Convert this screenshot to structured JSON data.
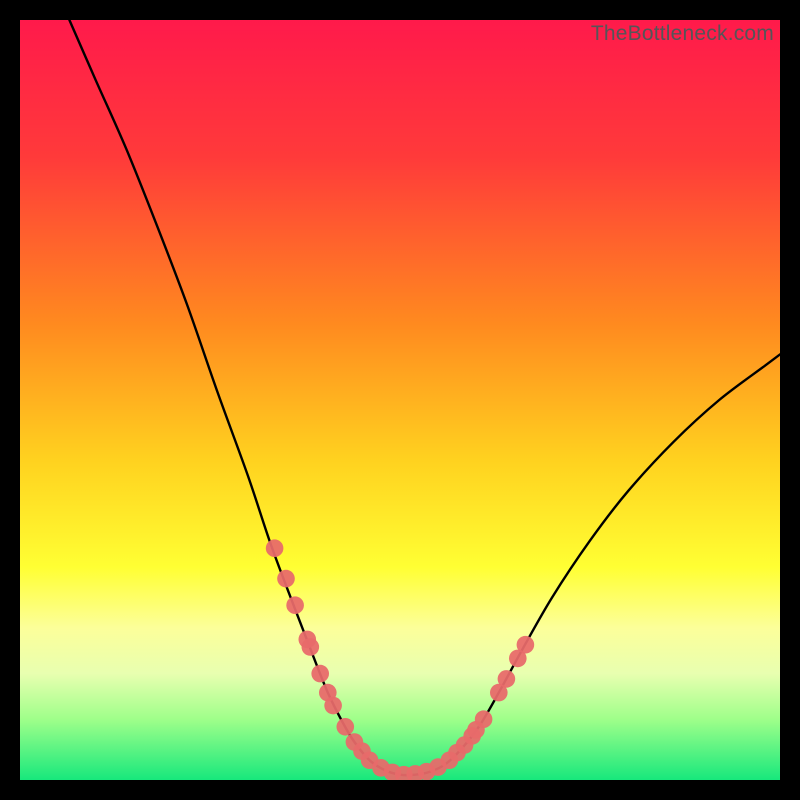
{
  "watermark": "TheBottleneck.com",
  "chart_data": {
    "type": "line",
    "title": "",
    "xlabel": "",
    "ylabel": "",
    "xlim": [
      0,
      100
    ],
    "ylim": [
      0,
      100
    ],
    "gradient_stops": [
      {
        "offset": 0,
        "color": "#ff1a4b"
      },
      {
        "offset": 18,
        "color": "#ff3a3a"
      },
      {
        "offset": 40,
        "color": "#ff8a1f"
      },
      {
        "offset": 58,
        "color": "#ffd21f"
      },
      {
        "offset": 72,
        "color": "#ffff33"
      },
      {
        "offset": 80,
        "color": "#fcff9a"
      },
      {
        "offset": 86,
        "color": "#e8ffb0"
      },
      {
        "offset": 92,
        "color": "#9fff8a"
      },
      {
        "offset": 100,
        "color": "#17e87c"
      }
    ],
    "series": [
      {
        "name": "bottleneck-curve",
        "type": "line",
        "x": [
          6.5,
          10,
          14,
          18,
          22,
          26,
          30,
          33,
          36,
          38.5,
          40.5,
          42.5,
          44,
          46,
          48,
          50,
          52,
          54,
          56,
          58,
          60.5,
          63,
          66,
          70,
          75,
          80,
          86,
          92,
          98,
          100
        ],
        "y": [
          100,
          92,
          83,
          73,
          62.5,
          51,
          40,
          31,
          23,
          16.5,
          11.5,
          7.5,
          5,
          2.6,
          1.3,
          0.7,
          0.7,
          1.1,
          2.1,
          4,
          7.2,
          11.5,
          17,
          24,
          31.5,
          38,
          44.5,
          50,
          54.5,
          56
        ]
      },
      {
        "name": "data-points-left",
        "type": "scatter",
        "x": [
          33.5,
          35,
          36.2,
          37.8,
          38.2,
          39.5,
          40.5,
          41.2,
          42.8,
          44.0,
          45.0
        ],
        "y": [
          30.5,
          26.5,
          23.0,
          18.5,
          17.5,
          14.0,
          11.5,
          9.8,
          7.0,
          5.0,
          3.8
        ]
      },
      {
        "name": "data-points-bottom",
        "type": "scatter",
        "x": [
          46.0,
          47.5,
          49.0,
          50.5,
          52.0,
          53.5,
          55.0
        ],
        "y": [
          2.6,
          1.6,
          1.0,
          0.7,
          0.8,
          1.1,
          1.7
        ]
      },
      {
        "name": "data-points-right",
        "type": "scatter",
        "x": [
          56.5,
          57.5,
          58.5,
          59.5,
          60.0,
          61.0,
          63.0,
          64.0,
          65.5,
          66.5
        ],
        "y": [
          2.6,
          3.6,
          4.6,
          5.8,
          6.6,
          8.0,
          11.5,
          13.3,
          16.0,
          17.8
        ]
      }
    ],
    "marker": {
      "radius": 8.8,
      "fill": "#e86a6a",
      "opacity": 0.94
    }
  }
}
